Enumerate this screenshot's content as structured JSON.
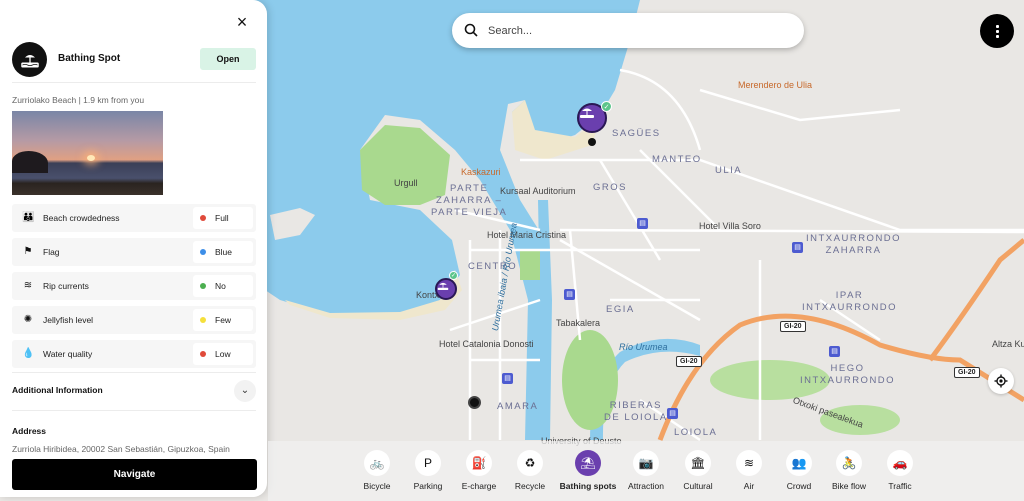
{
  "panel": {
    "close_label": "×",
    "spot_type": "Bathing Spot",
    "status": "Open",
    "status_color": "#d9f3e6",
    "subtitle": "Zurriolako Beach | 1.9 km from you",
    "photo_alt": "Sunset over the beach",
    "attributes": [
      {
        "icon": "crowd-icon",
        "label": "Beach crowdedness",
        "value": "Full",
        "dot_color": "#e04a3a"
      },
      {
        "icon": "flag-icon",
        "label": "Flag",
        "value": "Blue",
        "dot_color": "#3d8ee8"
      },
      {
        "icon": "waves-icon",
        "label": "Rip currents",
        "value": "No",
        "dot_color": "#4caf50"
      },
      {
        "icon": "jellyfish-icon",
        "label": "Jellyfish level",
        "value": "Few",
        "dot_color": "#f5e03c"
      },
      {
        "icon": "water-drop-icon",
        "label": "Water quality",
        "value": "Low",
        "dot_color": "#e04a3a"
      }
    ],
    "additional_info_label": "Additional Information",
    "address_label": "Address",
    "address": "Zurriola Hiribidea, 20002 San Sebastián, Gipuzkoa, Spain",
    "navigate_label": "Navigate"
  },
  "search": {
    "placeholder": "Search...",
    "value": ""
  },
  "map": {
    "labels": {
      "merendero": "Merendero de Ulia",
      "sagues": "SAGÜES",
      "manteo": "MANTEO",
      "ulia": "ULIA",
      "kaskazuri": "Kaskazuri",
      "urgull": "Urgull",
      "parte_vieja": "PARTE\nZAHARRA –\nPARTE VIEJA",
      "kursaal": "Kursaal Auditorium",
      "gros": "GROS",
      "hotel_villa_soro": "Hotel Villa Soro",
      "intxaurrondo_zaharra": "INTXAURRONDO\nZAHARRA",
      "hotel_maria_cristina": "Hotel Maria Cristina",
      "centro": "CENTRO",
      "kontxa": "Kontxa",
      "egia": "EGIA",
      "tabakalera": "Tabakalera",
      "ipar_intxaurrondo": "IPAR\nINTXAURRONDO",
      "hotel_catalonia": "Hotel Catalonia Donosti",
      "rio_urumea": "Río Urumea",
      "urumea_vertical": "Urumea ibaia / Río Urumea",
      "hego_intxaurrondo": "HEGO\nINTXAURRONDO",
      "altza": "Altza Ku",
      "otxoki": "Otxoki pasealekua",
      "amara": "AMARA",
      "riberas": "RIBERAS\nDE LOIOLA",
      "loiola": "LOIOLA",
      "deusto": "University of Deusto",
      "gi20": "GI-20"
    }
  },
  "categories": [
    {
      "label": "Bicycle",
      "icon": "bicycle-icon",
      "glyph": "🚲",
      "active": false
    },
    {
      "label": "Parking",
      "icon": "parking-icon",
      "glyph": "P",
      "active": false
    },
    {
      "label": "E-charge",
      "icon": "ev-charger-icon",
      "glyph": "⛽",
      "active": false
    },
    {
      "label": "Recycle",
      "icon": "recycle-icon",
      "glyph": "♻",
      "active": false
    },
    {
      "label": "Bathing spots",
      "icon": "beach-icon",
      "glyph": "⛱",
      "active": true
    },
    {
      "label": "Attraction",
      "icon": "camera-pin-icon",
      "glyph": "📷",
      "active": false
    },
    {
      "label": "Cultural",
      "icon": "museum-icon",
      "glyph": "🏛",
      "active": false
    },
    {
      "label": "Air",
      "icon": "wind-icon",
      "glyph": "≋",
      "active": false
    },
    {
      "label": "Crowd",
      "icon": "crowd-icon",
      "glyph": "👥",
      "active": false
    },
    {
      "label": "Bike flow",
      "icon": "cyclist-icon",
      "glyph": "🚴",
      "active": false
    },
    {
      "label": "Traffic",
      "icon": "car-icon",
      "glyph": "🚗",
      "active": false
    }
  ],
  "colors": {
    "accent": "#6a3fae",
    "water": "#8ccbec",
    "park": "#a9d98e",
    "highway": "#f2a263"
  }
}
